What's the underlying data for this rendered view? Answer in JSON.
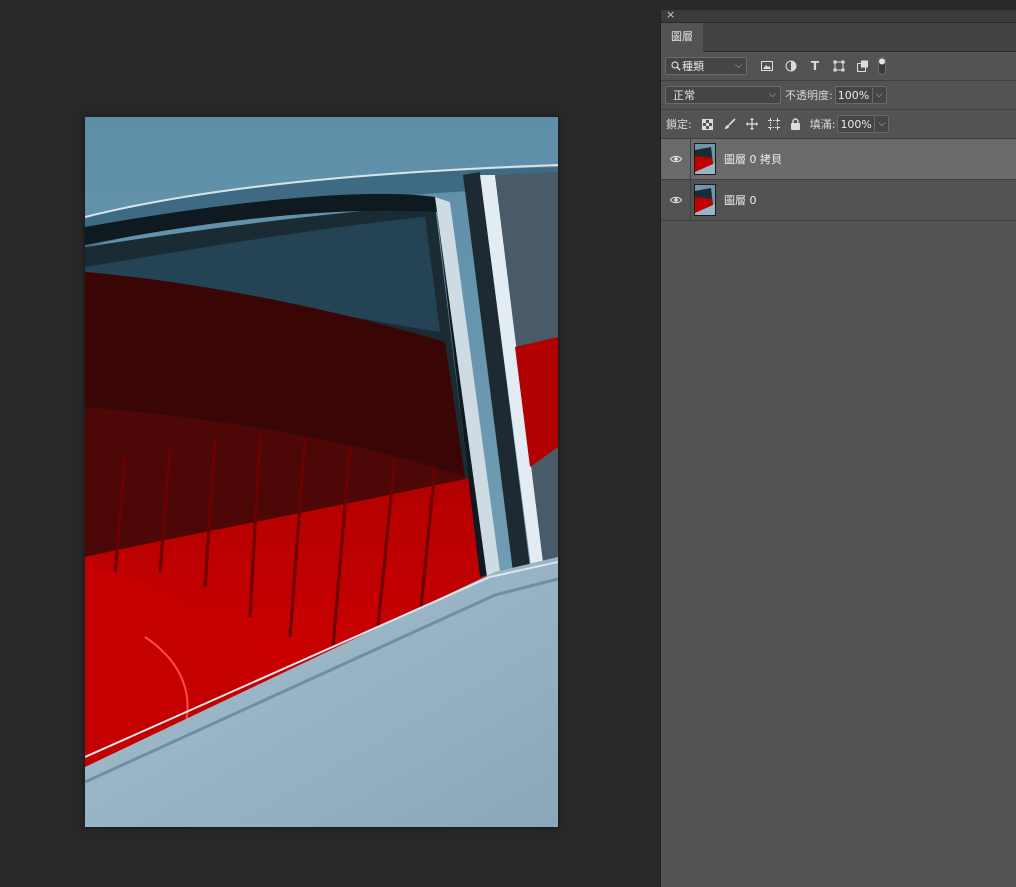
{
  "panel": {
    "close_glyph": "×",
    "tab_label": "圖層",
    "filter": {
      "label": "種類"
    },
    "blend_mode": "正常",
    "opacity_label": "不透明度:",
    "opacity_value": "100%",
    "lock_label": "鎖定:",
    "fill_label": "填滿:",
    "fill_value": "100%",
    "filter_icons": [
      "image-filter-icon",
      "adjustment-filter-icon",
      "type-filter-icon",
      "shape-filter-icon",
      "smart-object-filter-icon",
      "filter-toggle-icon"
    ],
    "lock_icons": [
      "lock-transparent-pixels-icon",
      "lock-image-pixels-icon",
      "lock-position-icon",
      "lock-artboard-icon",
      "lock-all-icon"
    ]
  },
  "layers": [
    {
      "name": "圖層 0 拷貝",
      "selected": true,
      "visible": true
    },
    {
      "name": "圖層 0",
      "selected": false,
      "visible": true
    }
  ],
  "colors": {
    "canvas_bg": "#282828",
    "panel_bg": "#535353",
    "selected_row": "#6a6a6a",
    "seat_red": "#d10000",
    "car_blue": "#7ea3b8"
  }
}
